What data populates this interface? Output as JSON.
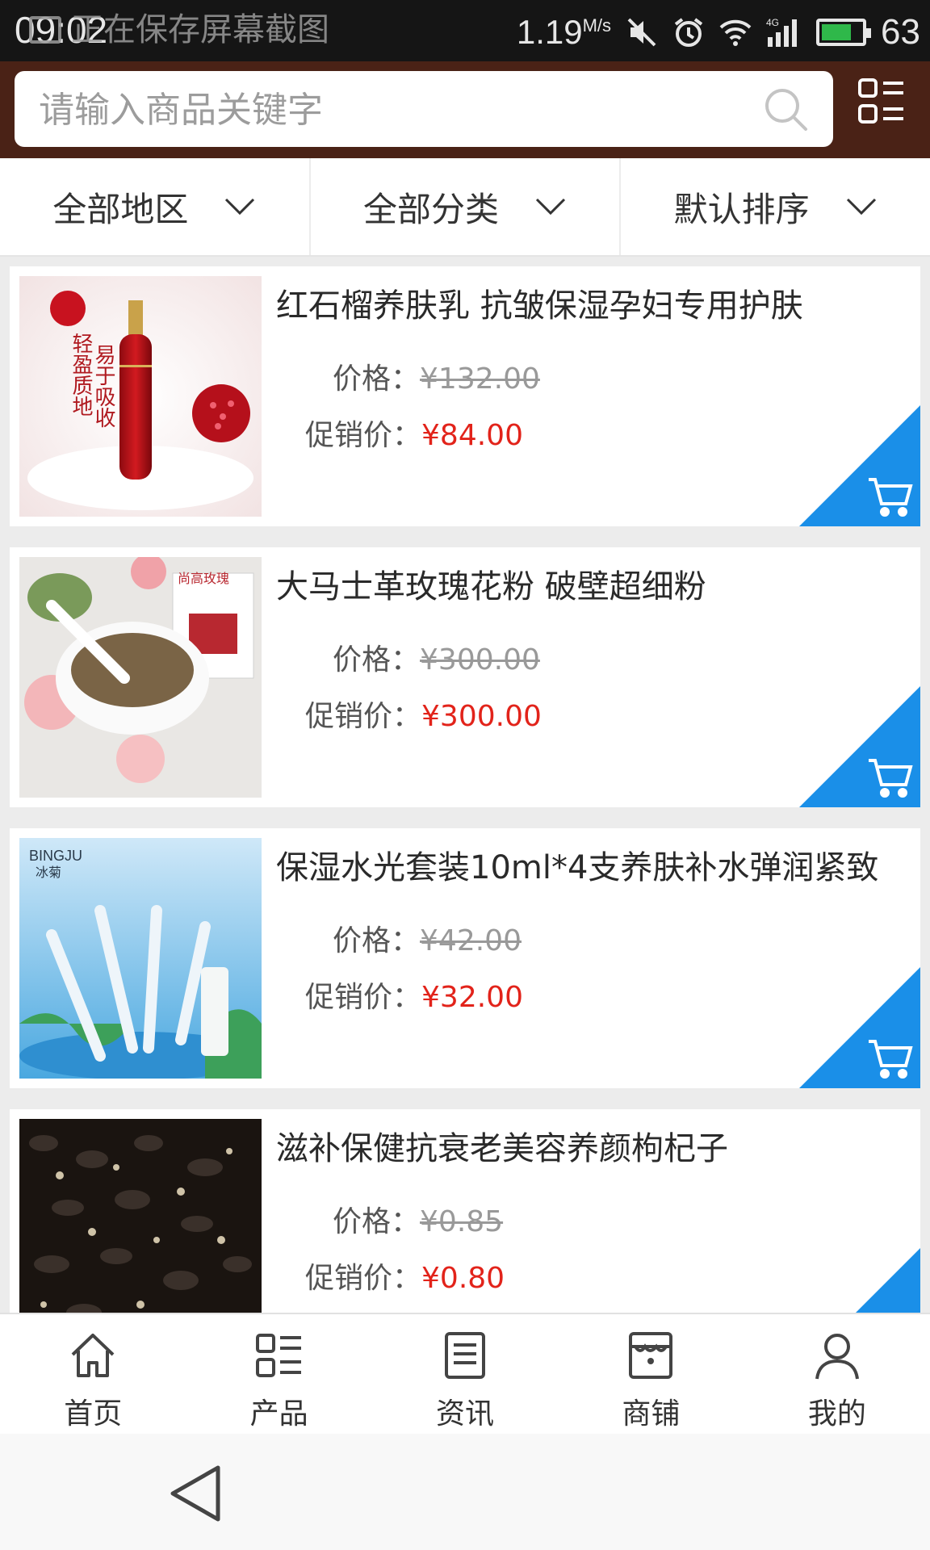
{
  "status_bar": {
    "time": "09:02",
    "notification": "正在保存屏幕截图",
    "speed": "1.19",
    "speed_unit": "M/s",
    "network": "4G",
    "battery": "63"
  },
  "search": {
    "placeholder": "请输入商品关键字"
  },
  "filters": [
    {
      "label": "全部地区"
    },
    {
      "label": "全部分类"
    },
    {
      "label": "默认排序"
    }
  ],
  "products": [
    {
      "title": "红石榴养肤乳 抗皱保湿孕妇专用护肤",
      "price_label": "价格：",
      "price": "¥132.00",
      "promo_label": "促销价：",
      "promo_price": "¥84.00",
      "image_text": [
        "轻盈质地",
        "易于吸收"
      ]
    },
    {
      "title": "大马士革玫瑰花粉 破壁超细粉",
      "price_label": "价格：",
      "price": "¥300.00",
      "promo_label": "促销价：",
      "promo_price": "¥300.00",
      "image_text": [
        "尚高玫瑰"
      ]
    },
    {
      "title": "保湿水光套装10ml*4支养肤补水弹润紧致",
      "price_label": "价格：",
      "price": "¥42.00",
      "promo_label": "促销价：",
      "promo_price": "¥32.00",
      "image_text": [
        "BINGJU",
        "冰菊"
      ]
    },
    {
      "title": "滋补保健抗衰老美容养颜枸杞子",
      "price_label": "价格：",
      "price": "¥0.85",
      "promo_label": "促销价：",
      "promo_price": "¥0.80",
      "image_text": []
    }
  ],
  "bottom_nav": [
    {
      "label": "首页",
      "icon": "home-icon"
    },
    {
      "label": "产品",
      "icon": "product-grid-icon"
    },
    {
      "label": "资讯",
      "icon": "news-icon"
    },
    {
      "label": "商铺",
      "icon": "shop-icon"
    },
    {
      "label": "我的",
      "icon": "user-icon"
    }
  ],
  "colors": {
    "header_bg": "#4a2216",
    "promo_price": "#e2231a",
    "cart_corner": "#1a8fe8"
  }
}
